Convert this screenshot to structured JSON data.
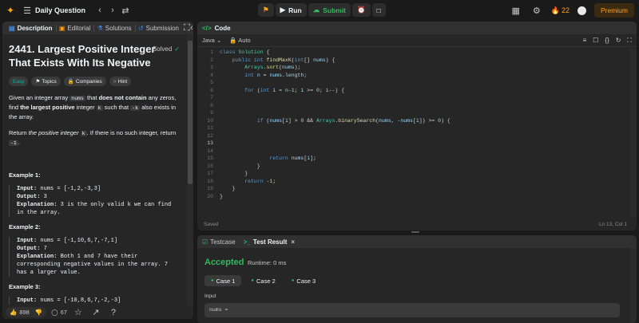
{
  "topbar": {
    "title": "Daily Question",
    "run_label": "Run",
    "submit_label": "Submit",
    "streak_count": "22",
    "premium_label": "Premium"
  },
  "left_tabs": {
    "description": "Description",
    "editorial": "Editorial",
    "solutions": "Solutions",
    "submissions": "Submission"
  },
  "problem": {
    "title": "2441. Largest Positive Integer That Exists With Its Negative",
    "status": "Solved",
    "difficulty": "Easy",
    "topics": "Topics",
    "companies": "Companies",
    "hint": "Hint",
    "p1_a": "Given an integer array ",
    "p1_code": "nums",
    "p1_b": " that ",
    "p1_bold1": "does not contain",
    "p1_c": " any zeros, find ",
    "p1_bold2": "the largest positive",
    "p1_d": " integer ",
    "p1_code2": "k",
    "p1_e": " such that ",
    "p1_code3": "-k",
    "p1_f": " also exists in the array.",
    "p2_a": "Return ",
    "p2_italic": "the positive integer",
    "p2_b": " ",
    "p2_code": "k",
    "p2_c": ". If there is no such integer, return ",
    "p2_code2": "-1",
    "p2_d": ".",
    "examples": [
      {
        "title": "Example 1:",
        "input": "nums = [-1,2,-3,3]",
        "output": "3",
        "explanation": "3 is the only valid k we can find in the array."
      },
      {
        "title": "Example 2:",
        "input": "nums = [-1,10,6,7,-7,1]",
        "output": "7",
        "explanation": "Both 1 and 7 have their corresponding negative values in the array. 7 has a larger value."
      },
      {
        "title": "Example 3:",
        "input": "nums = [-10,8,6,7,-2,-3]"
      }
    ],
    "label_input": "Input:",
    "label_output": "Output:",
    "label_explanation": "Explanation:"
  },
  "footer": {
    "likes": "898",
    "comments": "67"
  },
  "code": {
    "panel_title": "Code",
    "language": "Java",
    "auto": "Auto",
    "saved": "Saved",
    "cursor": "Ln 13, Col 1"
  },
  "result": {
    "tab_testcase": "Testcase",
    "tab_result": "Test Result",
    "verdict": "Accepted",
    "runtime": "Runtime: 0 ms",
    "cases": [
      "Case 1",
      "Case 2",
      "Case 3"
    ],
    "input_label": "Input",
    "input_value": "nums ="
  },
  "colors": {
    "accent_orange": "#ffa116",
    "accent_green": "#2cbb5d",
    "easy_teal": "#00b8a3"
  }
}
